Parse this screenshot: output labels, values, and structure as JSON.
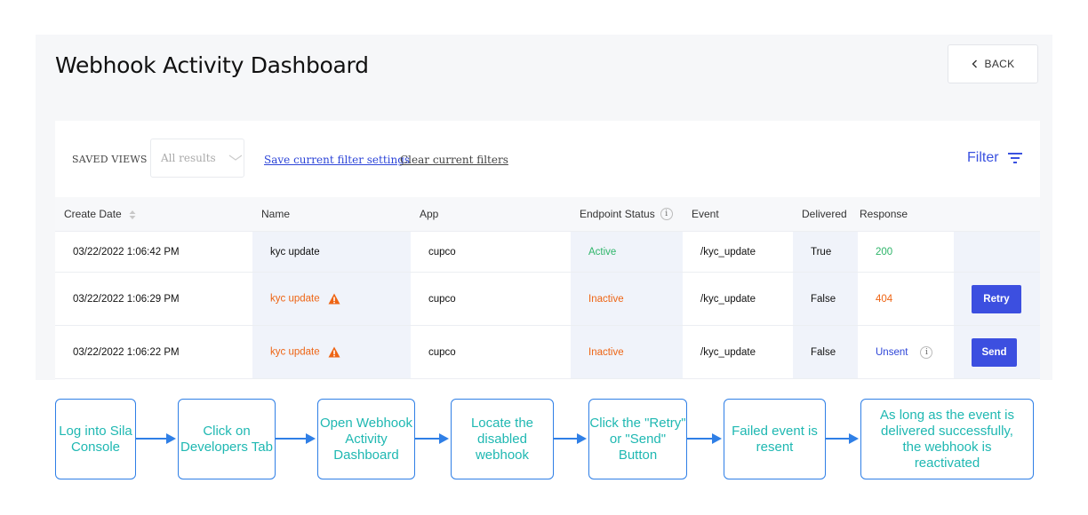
{
  "header": {
    "title": "Webhook Activity Dashboard",
    "back_label": "BACK"
  },
  "toolbar": {
    "saved_views_label": "SAVED VIEWS",
    "saved_views_value": "All results",
    "save_link": "Save current filter settings",
    "clear_link": "Clear current filters",
    "filter_label": "Filter"
  },
  "table": {
    "columns": [
      "Create Date",
      "Name",
      "App",
      "Endpoint Status",
      "Event",
      "Delivered",
      "Response",
      ""
    ],
    "rows": [
      {
        "date": "03/22/2022 1:06:42 PM",
        "name": "kyc update",
        "app": "cupco",
        "status": "Active",
        "event": "/kyc_update",
        "delivered": "True",
        "response": "200",
        "action": ""
      },
      {
        "date": "03/22/2022 1:06:29 PM",
        "name": "kyc update",
        "app": "cupco",
        "status": "Inactive",
        "event": "/kyc_update",
        "delivered": "False",
        "response": "404",
        "action": "Retry"
      },
      {
        "date": "03/22/2022 1:06:22 PM",
        "name": "kyc update",
        "app": "cupco",
        "status": "Inactive",
        "event": "/kyc_update",
        "delivered": "False",
        "response": "Unsent",
        "action": "Send"
      }
    ]
  },
  "flow": {
    "steps": [
      "Log into Sila Console",
      "Click on Developers Tab",
      "Open Webhook Activity Dashboard",
      "Locate the disabled webhook",
      "Click the \"Retry\" or \"Send\" Button",
      "Failed event is resent",
      "As long as the event is delivered successfully, the webhook is reactivated"
    ]
  },
  "colors": {
    "accent": "#3c4fe0",
    "active": "#2fb56a",
    "inactive": "#ee6515",
    "flow_border": "#2f7fe6",
    "flow_text": "#1fb8b2"
  },
  "icons": {
    "back": "chevron-left-icon",
    "filter": "filter-lines-icon",
    "sort": "sort-icon",
    "info": "info-icon",
    "warning": "warning-triangle-icon",
    "dropdown": "chevron-down-icon"
  }
}
